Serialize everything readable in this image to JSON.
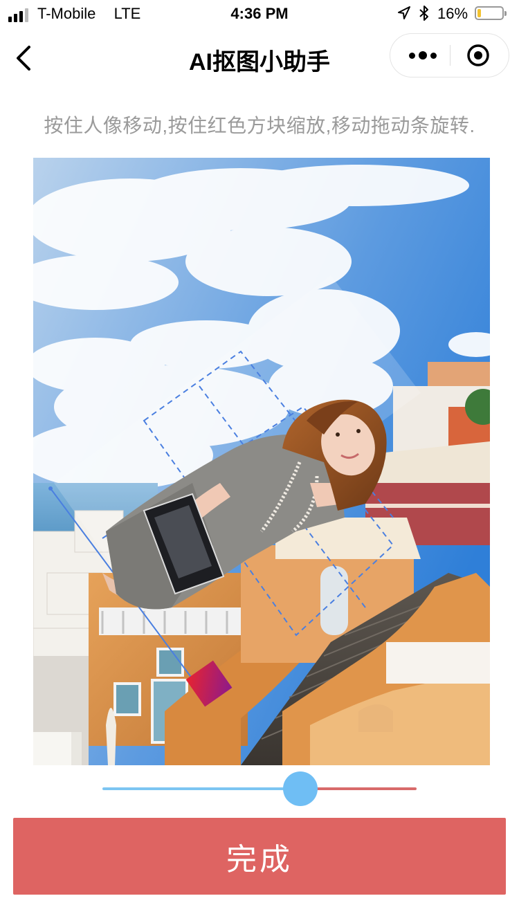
{
  "status_bar": {
    "carrier": "T-Mobile",
    "network": "LTE",
    "time": "4:36 PM",
    "battery_percent": "16%",
    "battery_level": 0.16,
    "signal_bars_active": 3,
    "signal_bars_total": 4
  },
  "nav": {
    "title": "AI抠图小助手",
    "back_icon": "back-chevron-icon",
    "more_icon": "more-dots-icon",
    "close_icon": "target-close-icon"
  },
  "hint_text": "按住人像移动,按住红色方块缩放,移动拖动条旋转.",
  "canvas": {
    "background": "santorini-street-scene",
    "cutout": "person-cutout",
    "handle_color": "#c2184f",
    "guide_color": "#4a7fe0"
  },
  "rotation_slider": {
    "value": 0.63,
    "fill_color": "#7cc5f2",
    "track_color": "#d86a6a",
    "thumb_color": "#6fbef4"
  },
  "done_button": {
    "label": "完成",
    "color": "#de6462"
  }
}
